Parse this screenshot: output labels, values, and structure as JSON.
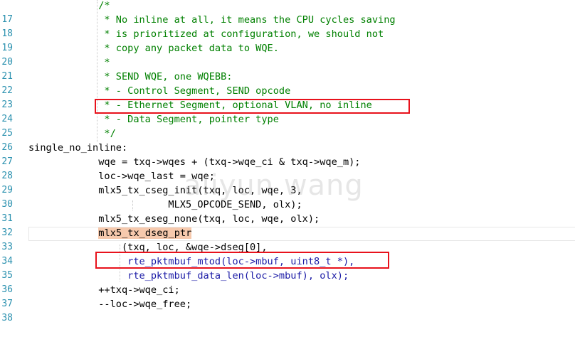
{
  "editor": {
    "watermark": "aliyun wang",
    "lines": [
      {
        "num": "17",
        "text": "            /*"
      },
      {
        "num": "18",
        "text": "             * No inline at all, it means the CPU cycles saving"
      },
      {
        "num": "19",
        "text": "             * is prioritized at configuration, we should not"
      },
      {
        "num": "20",
        "text": "             * copy any packet data to WQE."
      },
      {
        "num": "21",
        "text": "             *"
      },
      {
        "num": "22",
        "text": "             * SEND WQE, one WQEBB:"
      },
      {
        "num": "23",
        "text": "             * - Control Segment, SEND opcode"
      },
      {
        "num": "24",
        "text": "             * - Ethernet Segment, optional VLAN, no inline"
      },
      {
        "num": "25",
        "text": "             * - Data Segment, pointer type"
      },
      {
        "num": "26",
        "text": "             */"
      },
      {
        "num": "27",
        "text": "single_no_inline:"
      },
      {
        "num": "28",
        "text": "            wqe = txq->wqes + (txq->wqe_ci & txq->wqe_m);"
      },
      {
        "num": "29",
        "text": "            loc->wqe_last = wqe;"
      },
      {
        "num": "30",
        "text": "            mlx5_tx_cseg_init(txq, loc, wqe, 3,"
      },
      {
        "num": "31",
        "text": "                        MLX5_OPCODE_SEND, olx);"
      },
      {
        "num": "32",
        "text": "            mlx5_tx_eseg_none(txq, loc, wqe, olx);"
      },
      {
        "num": "33",
        "text": "            mlx5_tx_dseg_ptr"
      },
      {
        "num": "34",
        "text": "                (txq, loc, &wqe->dseg[0],"
      },
      {
        "num": "35",
        "text": "                 rte_pktmbuf_mtod(loc->mbuf, uint8_t *),"
      },
      {
        "num": "36",
        "text": "                 rte_pktmbuf_data_len(loc->mbuf), olx);"
      },
      {
        "num": "37",
        "text": "            ++txq->wqe_ci;"
      },
      {
        "num": "38",
        "text": "            --loc->wqe_free;"
      }
    ]
  }
}
